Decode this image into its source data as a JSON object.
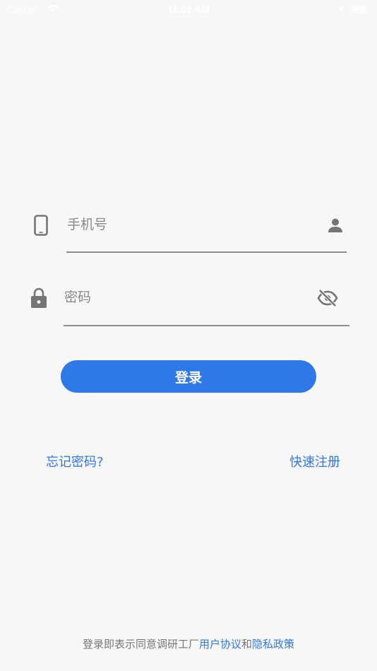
{
  "status_bar": {
    "carrier": "Carrier",
    "time": "11:09 AM"
  },
  "login_form": {
    "phone": {
      "placeholder": "手机号",
      "leading_icon": "smartphone-icon",
      "trailing_icon": "person-icon"
    },
    "password": {
      "placeholder": "密码",
      "leading_icon": "lock-icon",
      "trailing_icon": "eye-off-icon"
    },
    "login_button_label": "登录"
  },
  "links": {
    "forgot_password": "忘记密码?",
    "quick_register": "快速注册"
  },
  "agreement": {
    "prefix": "登录即表示同意调研工厂",
    "user_agreement": "用户协议",
    "conjunction": "和",
    "privacy_policy": "隐私政策"
  },
  "colors": {
    "accent": "#2f78e8",
    "background": "#f7f7f7",
    "icon": "#757575",
    "divider": "#8e8e8e"
  }
}
